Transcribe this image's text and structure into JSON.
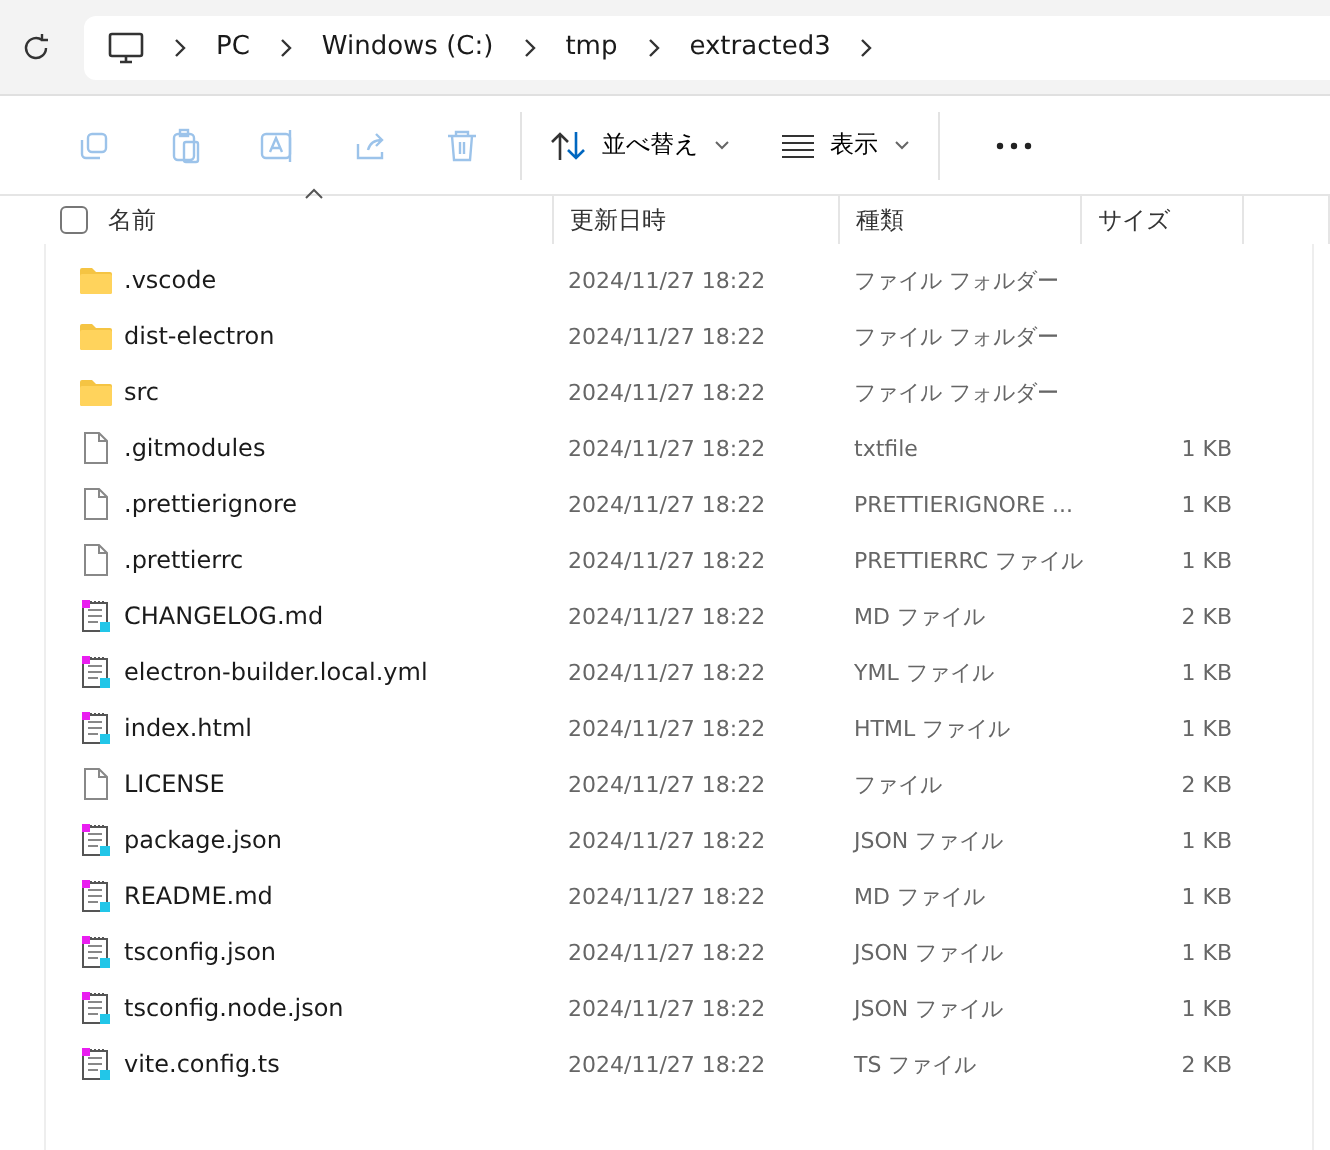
{
  "breadcrumb": [
    {
      "label": "PC"
    },
    {
      "label": "Windows (C:)"
    },
    {
      "label": "tmp"
    },
    {
      "label": "extracted3"
    }
  ],
  "toolbar": {
    "sort": "並べ替え",
    "view": "表示"
  },
  "columns": [
    {
      "label": "名前",
      "sorted": true
    },
    {
      "label": "更新日時",
      "sorted": false
    },
    {
      "label": "種類",
      "sorted": false
    },
    {
      "label": "サイズ",
      "sorted": false
    }
  ],
  "select_all": {
    "checked": false
  },
  "rows": [
    {
      "kind": "folder",
      "name": ".vscode",
      "date": "2024/11/27 18:22",
      "type": "ファイル フォルダー"
    },
    {
      "kind": "folder",
      "name": "dist-electron",
      "date": "2024/11/27 18:22",
      "type": "ファイル フォルダー"
    },
    {
      "kind": "folder",
      "name": "src",
      "date": "2024/11/27 18:22",
      "type": "ファイル フォルダー"
    },
    {
      "kind": "file",
      "name": ".gitmodules",
      "date": "2024/11/27 18:22",
      "type": "txtfile",
      "size": "1 KB"
    },
    {
      "kind": "file",
      "name": ".prettierignore",
      "date": "2024/11/27 18:22",
      "type": "PRETTIERIGNORE ...",
      "size": "1 KB"
    },
    {
      "kind": "file",
      "name": ".prettierrc",
      "date": "2024/11/27 18:22",
      "type": "PRETTIERRC ファイル",
      "size": "1 KB"
    },
    {
      "kind": "text",
      "name": "CHANGELOG.md",
      "date": "2024/11/27 18:22",
      "type": "MD ファイル",
      "size": "2 KB"
    },
    {
      "kind": "text",
      "name": "electron-builder.local.yml",
      "date": "2024/11/27 18:22",
      "type": "YML ファイル",
      "size": "1 KB"
    },
    {
      "kind": "text",
      "name": "index.html",
      "date": "2024/11/27 18:22",
      "type": "HTML ファイル",
      "size": "1 KB"
    },
    {
      "kind": "file",
      "name": "LICENSE",
      "date": "2024/11/27 18:22",
      "type": "ファイル",
      "size": "2 KB"
    },
    {
      "kind": "text",
      "name": "package.json",
      "date": "2024/11/27 18:22",
      "type": "JSON ファイル",
      "size": "1 KB"
    },
    {
      "kind": "text",
      "name": "README.md",
      "date": "2024/11/27 18:22",
      "type": "MD ファイル",
      "size": "1 KB"
    },
    {
      "kind": "text",
      "name": "tsconfig.json",
      "date": "2024/11/27 18:22",
      "type": "JSON ファイル",
      "size": "1 KB"
    },
    {
      "kind": "text",
      "name": "tsconfig.node.json",
      "date": "2024/11/27 18:22",
      "type": "JSON ファイル",
      "size": "1 KB"
    },
    {
      "kind": "text",
      "name": "vite.config.ts",
      "date": "2024/11/27 18:22",
      "type": "TS ファイル",
      "size": "2 KB"
    }
  ]
}
